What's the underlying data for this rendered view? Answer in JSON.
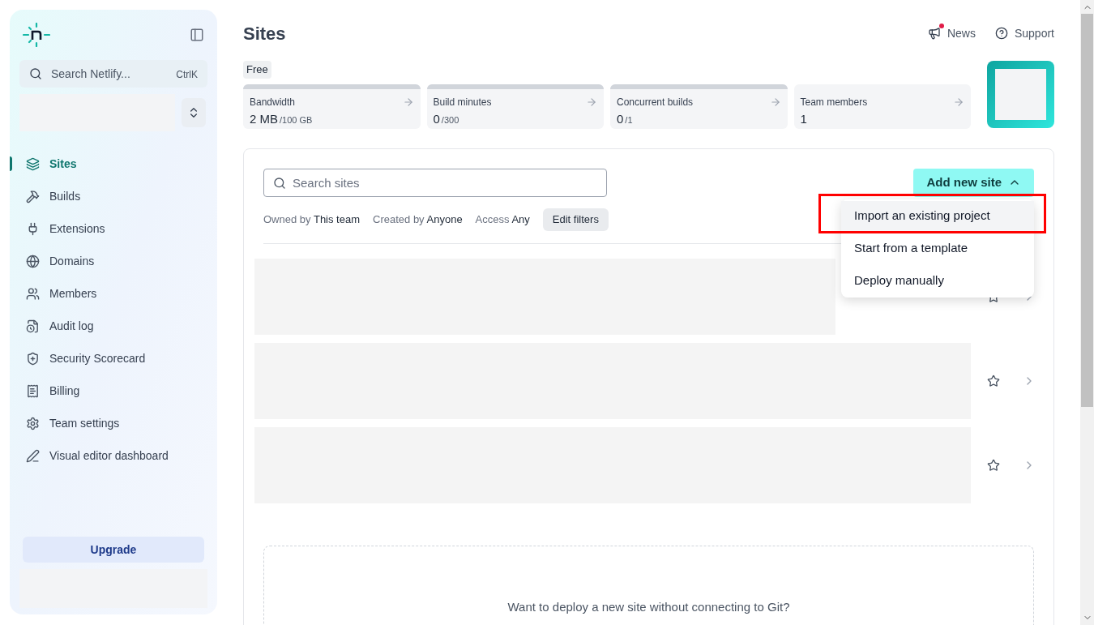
{
  "sidebar": {
    "search": {
      "placeholder": "Search Netlify...",
      "shortcut": "CtrlK"
    },
    "nav": [
      {
        "label": "Sites",
        "selected": true
      },
      {
        "label": "Builds",
        "selected": false
      },
      {
        "label": "Extensions",
        "selected": false
      },
      {
        "label": "Domains",
        "selected": false
      },
      {
        "label": "Members",
        "selected": false
      },
      {
        "label": "Audit log",
        "selected": false
      },
      {
        "label": "Security Scorecard",
        "selected": false
      },
      {
        "label": "Billing",
        "selected": false
      },
      {
        "label": "Team settings",
        "selected": false
      },
      {
        "label": "Visual editor dashboard",
        "selected": false
      }
    ],
    "upgrade_button": "Upgrade"
  },
  "header": {
    "title": "Sites",
    "links": [
      {
        "label": "News",
        "unread": true
      },
      {
        "label": "Support",
        "unread": false
      }
    ]
  },
  "plan_badge": "Free",
  "usage_cards": [
    {
      "kind": "meter",
      "label": "Bandwidth",
      "value": "2 MB",
      "limit": "/100 GB"
    },
    {
      "kind": "meter",
      "label": "Build minutes",
      "value": "0",
      "limit": "/300"
    },
    {
      "kind": "meter",
      "label": "Concurrent builds",
      "value": "0",
      "limit": "/1"
    },
    {
      "kind": "count",
      "label": "Team members",
      "value": "1"
    }
  ],
  "sites_panel": {
    "search": {
      "placeholder": "Search sites"
    },
    "filters": [
      {
        "name": "Owned by",
        "value": "This team"
      },
      {
        "name": "Created by",
        "value": "Anyone"
      },
      {
        "name": "Access",
        "value": "Any"
      }
    ],
    "edit_filters_button": "Edit filters",
    "add_button": {
      "label": "Add new site",
      "expanded": true
    },
    "menu": [
      {
        "label": "Import an existing project",
        "highlighted": true
      },
      {
        "label": "Start from a template",
        "highlighted": false
      },
      {
        "label": "Deploy manually",
        "highlighted": false
      }
    ],
    "rows": [
      {
        "kind": "skeleton"
      },
      {
        "kind": "skeleton"
      },
      {
        "kind": "skeleton"
      }
    ],
    "manual_deploy_prompt": "Want to deploy a new site without connecting to Git?"
  }
}
